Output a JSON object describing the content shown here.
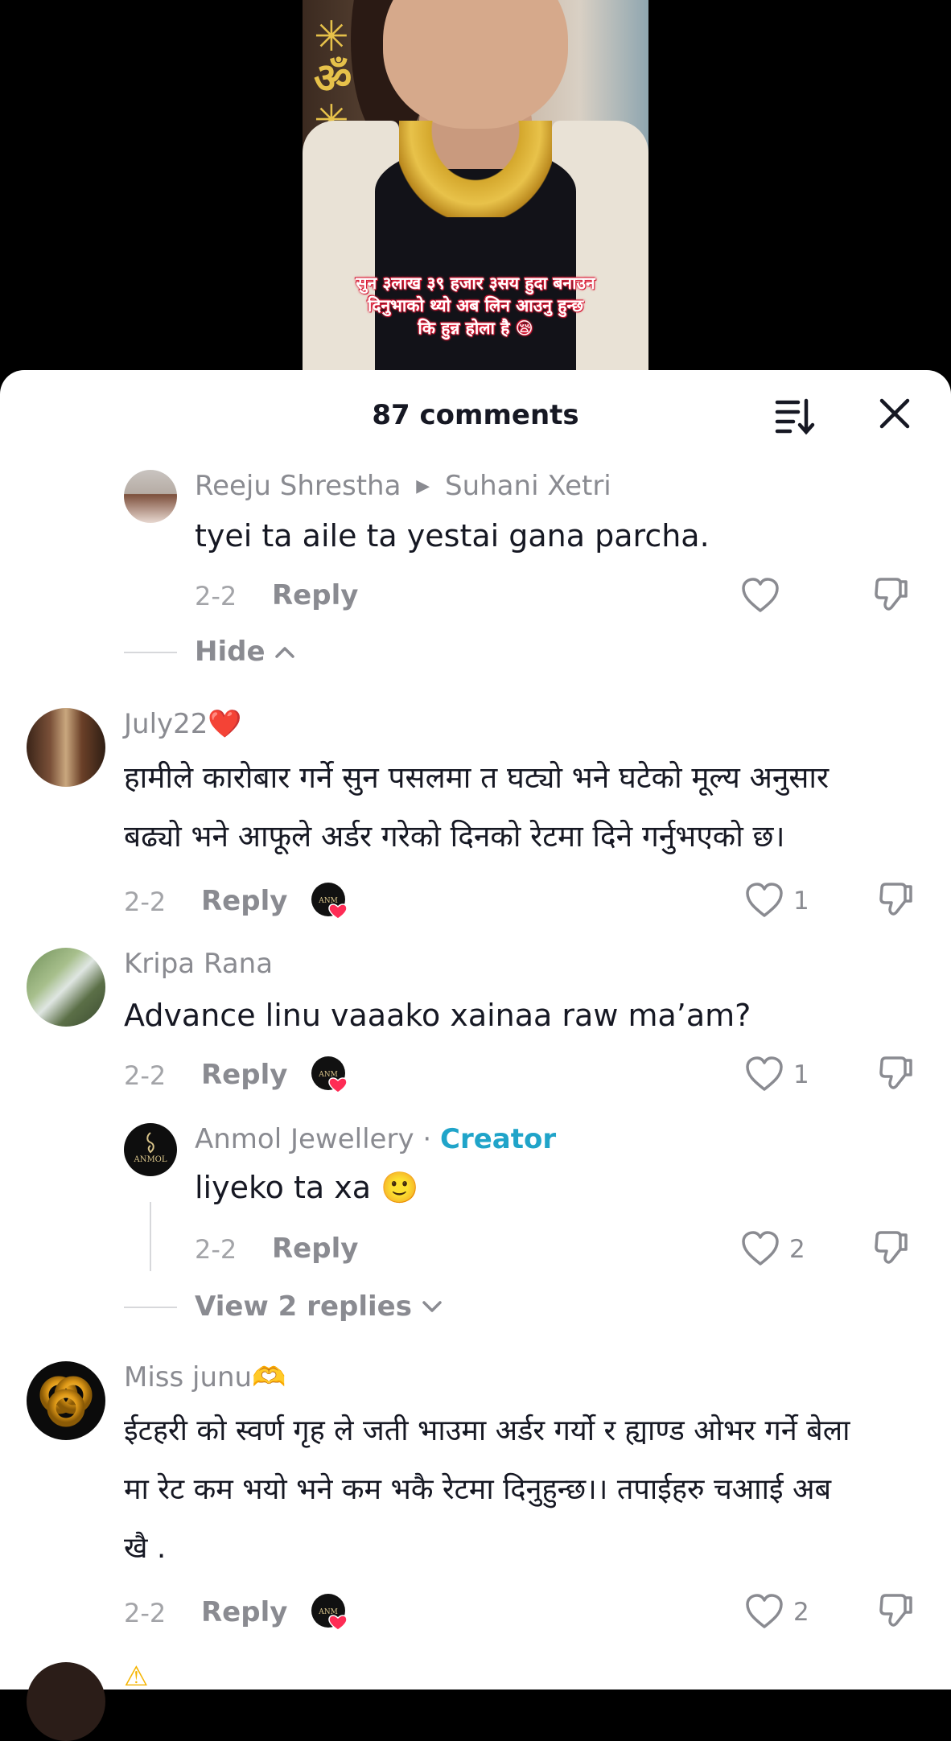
{
  "video": {
    "caption_line1": "सुन ३लाख ३९ हजार ३सय हुदा बनाउन",
    "caption_line2": "दिनुभाको थ्यो अब लिन आउनु हुन्छ",
    "caption_line3": "कि हुन्न होला है 😪"
  },
  "sheet": {
    "title": "87 comments",
    "icons": {
      "sort": "sort-icon",
      "close": "close-icon"
    }
  },
  "comments": [
    {
      "author": "Reeju Shrestha",
      "reply_to": "Suhani Xetri",
      "text": "tyei ta aile ta yestai gana parcha.",
      "date": "2-2",
      "reply_label": "Reply",
      "hide_label": "Hide"
    },
    {
      "author": "July22❤️",
      "text_line1": "हामीले कारोबार गर्ने सुन पसलमा त घट्यो भने घटेको मूल्य अनुसार",
      "text_line2": "बढ्यो भने आफूले अर्डर गरेको दिनको रेटमा दिने गर्नुभएको छ।",
      "date": "2-2",
      "reply_label": "Reply",
      "likes": "1"
    },
    {
      "author": "Kripa Rana",
      "text": "Advance linu vaaako xainaa raw ma’am?",
      "date": "2-2",
      "reply_label": "Reply",
      "likes": "1"
    },
    {
      "author": "Anmol Jewellery",
      "separator": "·",
      "badge": "Creator",
      "avatar_text": "ANMOL",
      "text": "liyeko ta xa 🙂",
      "date": "2-2",
      "reply_label": "Reply",
      "likes": "2",
      "view_replies_label": "View 2 replies"
    },
    {
      "author": "Miss junu🫶",
      "text_line1": "ईटहरी को स्वर्ण गृह ले जती भाउमा अर्डर गर्यो र ह्याण्ड ओभर गर्ने बेला",
      "text_line2": "मा रेट कम भयो भने कम भकै रेटमा दिनुहुन्छ।। तपाईहरु चआाई अब",
      "text_line3": "खै .",
      "date": "2-2",
      "reply_label": "Reply",
      "likes": "2"
    },
    {
      "author": "⚠"
    }
  ],
  "colors": {
    "creator_badge": "#20a4c9",
    "liked_heart": "#fe2c55",
    "secondary_text": "#8a8b91"
  }
}
